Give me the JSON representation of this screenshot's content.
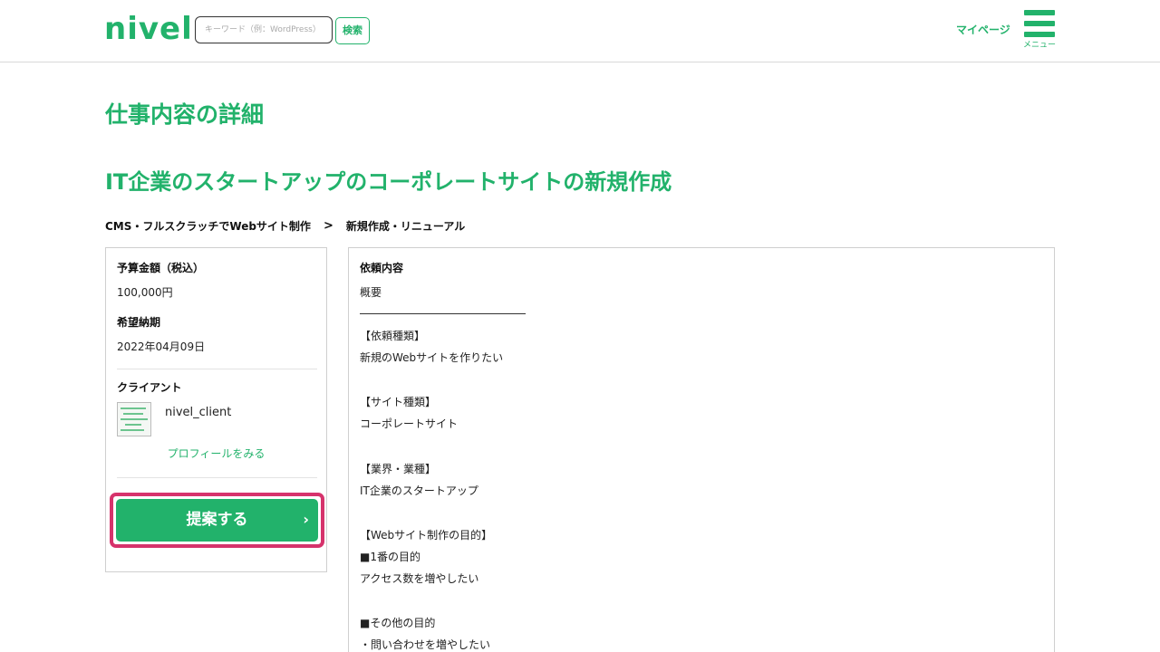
{
  "header": {
    "logo": "nivel",
    "search_placeholder": "キーワード（例：WordPress）",
    "search_button": "検索",
    "mypage": "マイページ",
    "menu_label": "メニュー",
    "accent_color": "#22b26b"
  },
  "page_title": "仕事内容の詳細",
  "job": {
    "title": "IT企業のスタートアップのコーポレートサイトの新規作成",
    "breadcrumb": {
      "category": "CMS・フルスクラッチでWebサイト制作",
      "separator": ">",
      "subcategory": "新規作成・リニューアル"
    }
  },
  "summary": {
    "budget_label": "予算金額（税込）",
    "budget_value": "100,000円",
    "deadline_label": "希望納期",
    "deadline_value": "2022年04月09日",
    "client_label": "クライアント",
    "client_name": "nivel_client",
    "profile_link": "プロフィールをみる",
    "propose_button": "提案する",
    "propose_chevron": "›",
    "highlight_color": "#d6336c"
  },
  "details": {
    "heading": "依頼内容",
    "lines": [
      "概要",
      "【依頼種類】",
      "新規のWebサイトを作りたい",
      "【サイト種類】",
      "コーポレートサイト",
      "【業界・業種】",
      "IT企業のスタートアップ",
      "【Webサイト制作の目的】",
      "■1番の目的",
      "アクセス数を増やしたい",
      "■その他の目的",
      "・問い合わせを増やしたい"
    ]
  }
}
